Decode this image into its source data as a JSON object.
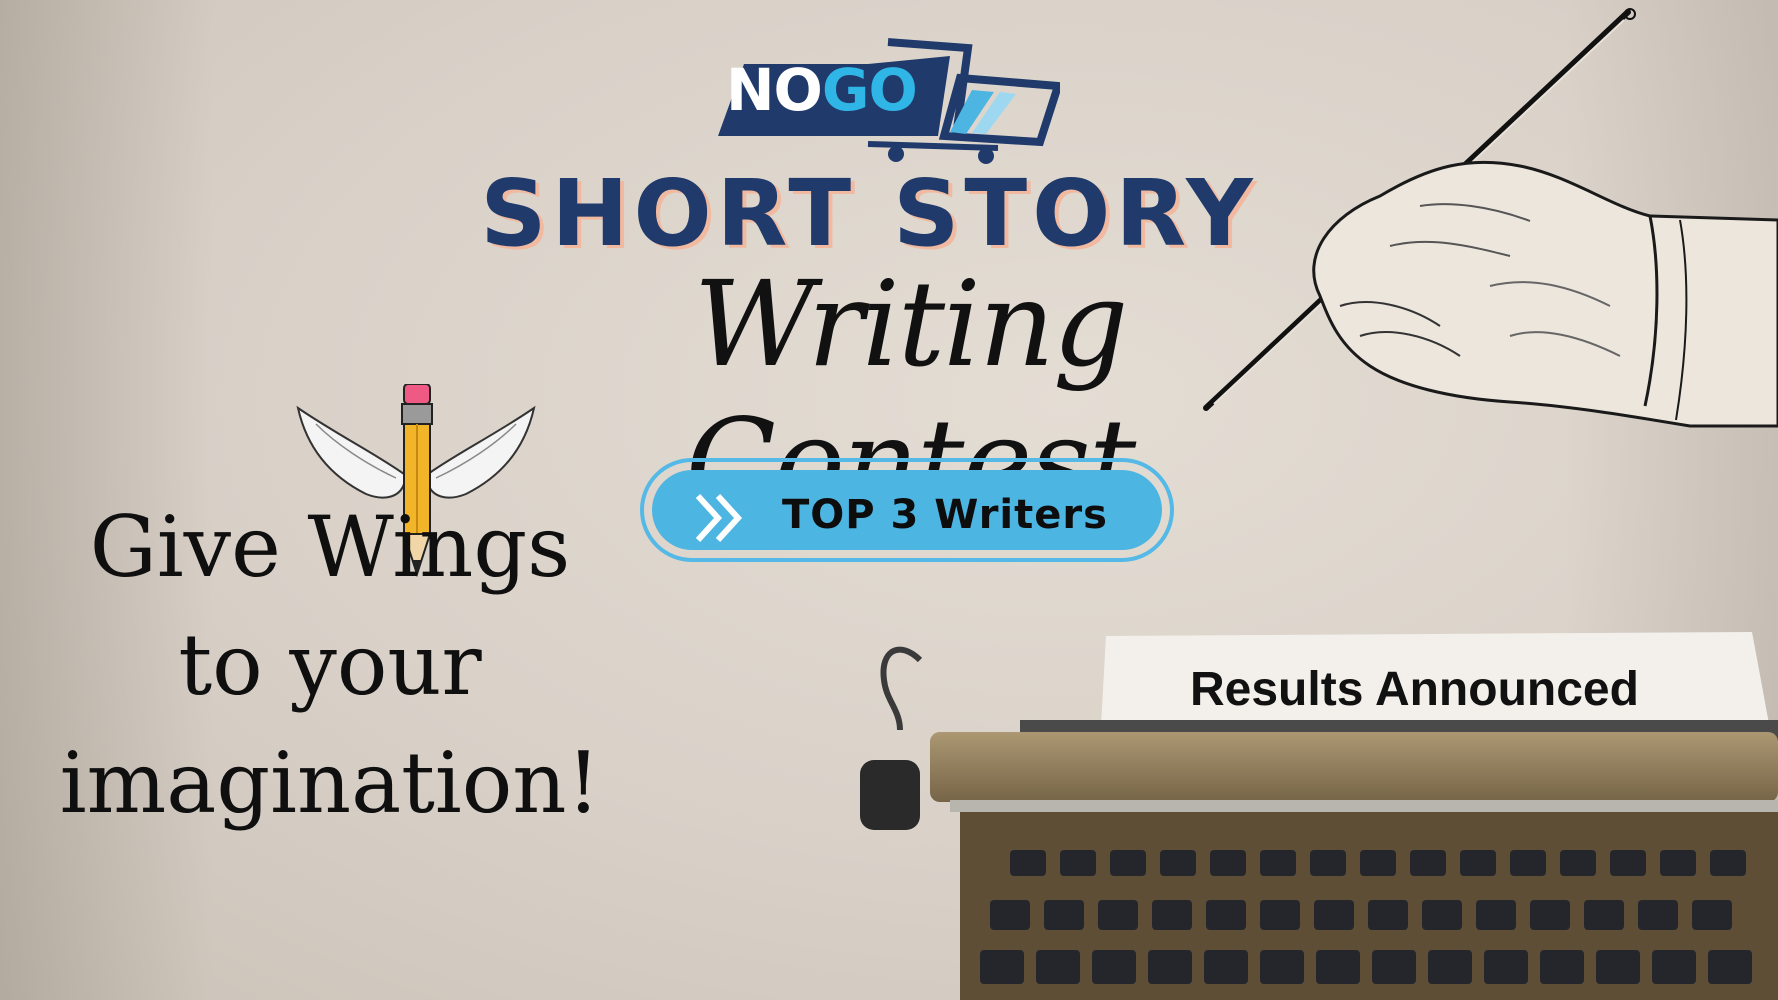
{
  "brand": {
    "logo_part1": "NO",
    "logo_part2": "GO"
  },
  "headline": {
    "line1": "SHORT STORY",
    "line2": "Writing Contest"
  },
  "cta": {
    "label": "TOP 3 Writers",
    "icon": "double-chevron-right-icon"
  },
  "tagline": {
    "line1": "Give Wings",
    "line2": "to your",
    "line3": "imagination!"
  },
  "paper": {
    "text": "Results Announced"
  },
  "colors": {
    "navy": "#1f3a6b",
    "accent_blue": "#4db5e2",
    "logo_blue": "#2fb5e6",
    "shadow_peach": "#f0b9a0",
    "background": "#ddd6cd"
  },
  "illustrations": [
    "hand-writing-with-pen-icon",
    "winged-pencil-icon",
    "typewriter-photo",
    "shopping-cart-icon"
  ]
}
